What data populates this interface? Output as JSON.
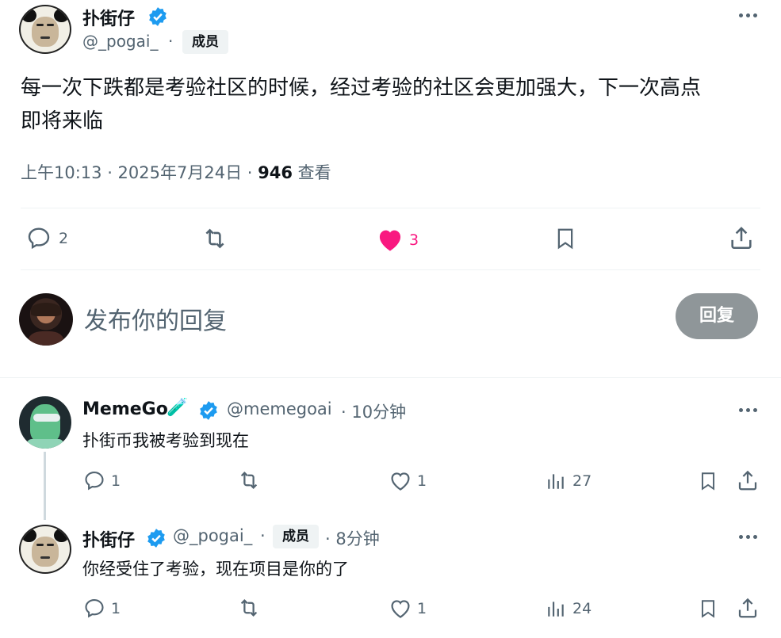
{
  "main_post": {
    "display_name": "扑街仔",
    "handle": "@_pogai_",
    "dot": "·",
    "badge": "成员",
    "text_line1": "每一次下跌都是考验社区的时候，经过考验的社区会更加强大，下一次高点",
    "text_line2": "即将来临",
    "time": "上午10:13 · 2025年7月24日 ·",
    "views_count": "946",
    "views_label": "查看",
    "replies": "2",
    "likes": "3",
    "like_color": "#f91880"
  },
  "reply_box": {
    "placeholder": "发布你的回复",
    "button_label": "回复"
  },
  "replies": [
    {
      "display_name": "MemeGo",
      "handle": "@memegoai",
      "time": "· 10分钟",
      "text": "扑街币我被考验到现在",
      "replies": "1",
      "likes": "1",
      "views": "27"
    },
    {
      "display_name": "扑街仔",
      "handle": "@_pogai_",
      "dot": "·",
      "badge": "成员",
      "time": "· 8分钟",
      "text": "你经受住了考验，现在项目是你的了",
      "replies": "1",
      "likes": "1",
      "views": "24"
    }
  ],
  "colors": {
    "accent_blue": "#1d9bf0",
    "muted": "#536471",
    "reply_button_bg": "#8f9699"
  }
}
